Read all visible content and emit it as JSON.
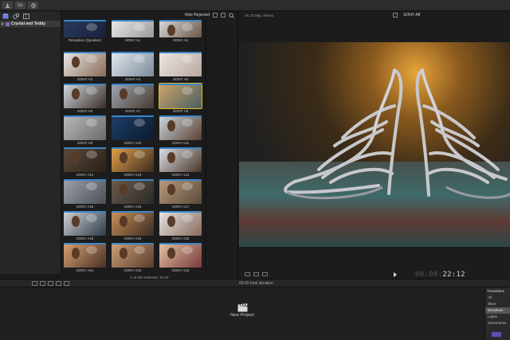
{
  "toolbar": {
    "buttons": [
      {
        "name": "import-button",
        "label": ""
      },
      {
        "name": "keyword-button",
        "label": "Go"
      },
      {
        "name": "background-tasks-button",
        "label": ""
      }
    ]
  },
  "sidebar": {
    "library_name": "Crystal and Teddy"
  },
  "browser": {
    "filter_label": "Hide Rejected",
    "footer": "1 of 201 selected, 31:13",
    "clips": [
      {
        "name": "Reception (Speaker)",
        "c1": "#2a3a5c",
        "c2": "#16203a",
        "skin": false
      },
      {
        "name": "SONY A1",
        "c1": "#e8e8e8",
        "c2": "#9a9a9a",
        "skin": false
      },
      {
        "name": "SONY A2",
        "c1": "#d9d9d9",
        "c2": "#6b5545",
        "skin": true
      },
      {
        "name": "SONY A3",
        "c1": "#e6e6e6",
        "c2": "#8a6a55",
        "skin": true
      },
      {
        "name": "SONY A4",
        "c1": "#e2e8ee",
        "c2": "#7a8a9a",
        "skin": false
      },
      {
        "name": "SONY A5",
        "c1": "#ece6e2",
        "c2": "#b8a8a0",
        "skin": false
      },
      {
        "name": "SONY A6",
        "c1": "#cfd6dd",
        "c2": "#3a2e28",
        "skin": true
      },
      {
        "name": "SONY A7",
        "c1": "#9aa6b0",
        "c2": "#4a3a30",
        "skin": true
      },
      {
        "name": "SONY A8",
        "c1": "#c9a368",
        "c2": "#4a5f62",
        "skin": false
      },
      {
        "name": "SONY A9",
        "c1": "#b8b8b8",
        "c2": "#6a6a6a",
        "skin": false
      },
      {
        "name": "SONY A10",
        "c1": "#1e3e66",
        "c2": "#0c1a2e",
        "skin": false
      },
      {
        "name": "SONY A11",
        "c1": "#c8d4dc",
        "c2": "#5a4030",
        "skin": true
      },
      {
        "name": "SONY A12",
        "c1": "#5a4a3a",
        "c2": "#2a2018",
        "skin": true
      },
      {
        "name": "SONY A13",
        "c1": "#e0a048",
        "c2": "#3a2a20",
        "skin": true
      },
      {
        "name": "SONY A14",
        "c1": "#d8dee4",
        "c2": "#4a3426",
        "skin": true
      },
      {
        "name": "SONY A15",
        "c1": "#9aa0a6",
        "c2": "#4a5056",
        "skin": false
      },
      {
        "name": "SONY A16",
        "c1": "#6a5a4a",
        "c2": "#2a2a2a",
        "skin": true
      },
      {
        "name": "SONY A17",
        "c1": "#b89a7a",
        "c2": "#5a4a3a",
        "skin": true
      },
      {
        "name": "SONY A18",
        "c1": "#d0d0d0",
        "c2": "#2a3a4a",
        "skin": true
      },
      {
        "name": "SONY A19",
        "c1": "#c89058",
        "c2": "#3a2a22",
        "skin": true
      },
      {
        "name": "SONY A20",
        "c1": "#e4e4e4",
        "c2": "#8a6a5a",
        "skin": true
      },
      {
        "name": "SONY A21",
        "c1": "#d4a070",
        "c2": "#4a3026",
        "skin": true
      },
      {
        "name": "SONY A22",
        "c1": "#caa078",
        "c2": "#5a3a2a",
        "skin": true
      },
      {
        "name": "SONY A23",
        "c1": "#e0c0a0",
        "c2": "#7a3a3a",
        "skin": true
      }
    ]
  },
  "viewer": {
    "format": "4K 23.98p, Stereo",
    "title": "SONY A8",
    "timecode_dim": "00:00:",
    "timecode": "22:12"
  },
  "timeline": {
    "duration": "00:00 total duration",
    "new_project": "New Project"
  },
  "transitions": {
    "title": "Transitions",
    "items": [
      "All",
      "Blurs",
      "Dissolves",
      "Lights",
      "Movements"
    ],
    "selected_index": 2
  },
  "colors": {
    "accent": "#5b4fb8",
    "selection": "#e3b526",
    "clip_strip": "#3a86c8"
  }
}
